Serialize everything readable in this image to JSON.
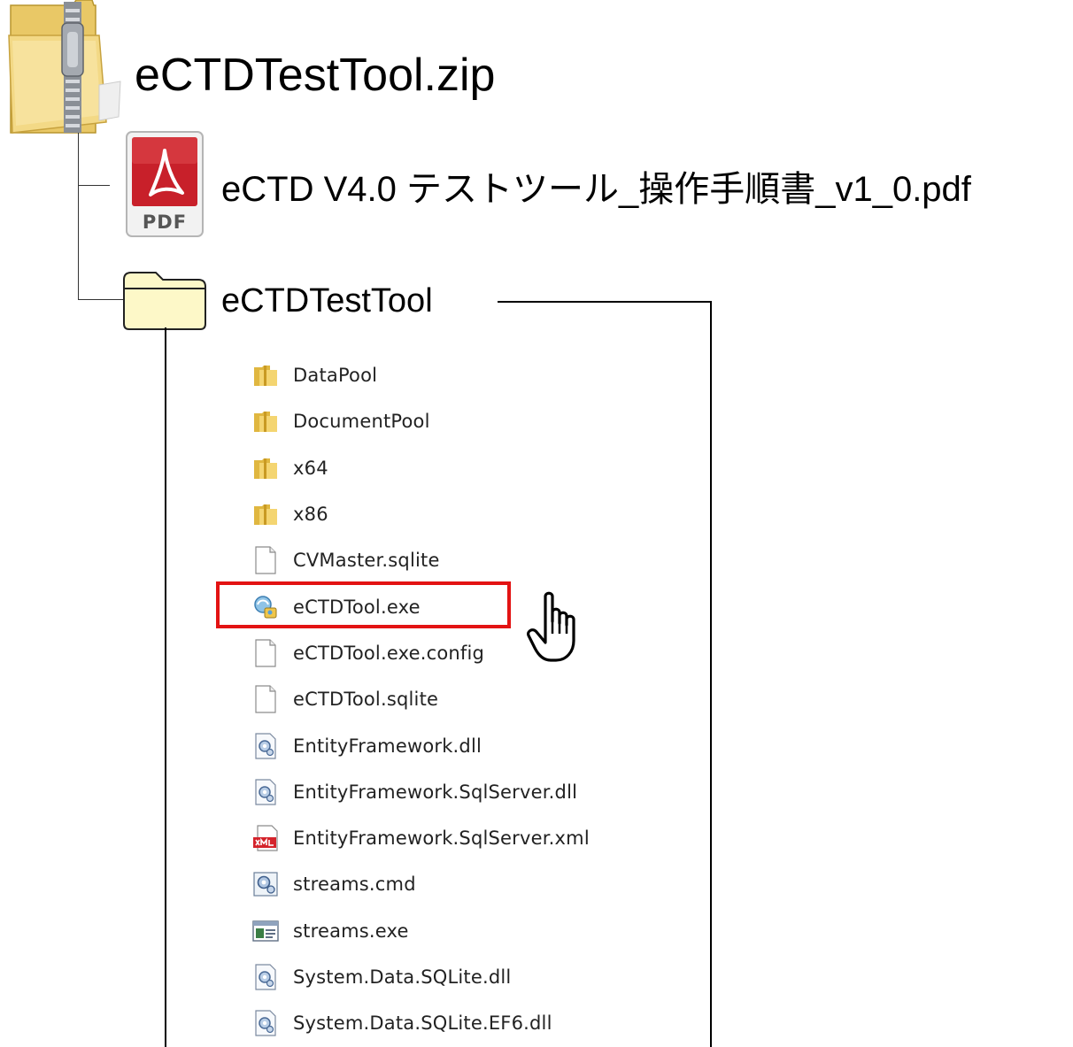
{
  "zip": {
    "label": "eCTDTestTool.zip",
    "icon": "zip-folder-icon"
  },
  "pdf": {
    "label": "eCTD V4.0 テストツール_操作手順書_v1_0.pdf",
    "icon": "pdf-icon",
    "icon_text": "PDF",
    "brand_color": "#c8202a"
  },
  "folder": {
    "label": "eCTDTestTool",
    "icon": "folder-icon",
    "fill_color": "#fdf8c8"
  },
  "files": [
    {
      "name": "DataPool",
      "icon": "folder-icon"
    },
    {
      "name": "DocumentPool",
      "icon": "folder-icon"
    },
    {
      "name": "x64",
      "icon": "folder-icon"
    },
    {
      "name": "x86",
      "icon": "folder-icon"
    },
    {
      "name": "CVMaster.sqlite",
      "icon": "blank-file-icon"
    },
    {
      "name": "eCTDTool.exe",
      "icon": "exe-app-icon",
      "highlighted": true
    },
    {
      "name": "eCTDTool.exe.config",
      "icon": "blank-file-icon"
    },
    {
      "name": "eCTDTool.sqlite",
      "icon": "blank-file-icon"
    },
    {
      "name": "EntityFramework.dll",
      "icon": "dll-gear-icon"
    },
    {
      "name": "EntityFramework.SqlServer.dll",
      "icon": "dll-gear-icon"
    },
    {
      "name": "EntityFramework.SqlServer.xml",
      "icon": "xml-file-icon"
    },
    {
      "name": "streams.cmd",
      "icon": "cmd-gear-icon"
    },
    {
      "name": "streams.exe",
      "icon": "window-exe-icon"
    },
    {
      "name": "System.Data.SQLite.dll",
      "icon": "dll-gear-icon"
    },
    {
      "name": "System.Data.SQLite.EF6.dll",
      "icon": "dll-gear-icon"
    }
  ],
  "highlight_color": "#e31313",
  "cursor": "hand-pointer-icon"
}
